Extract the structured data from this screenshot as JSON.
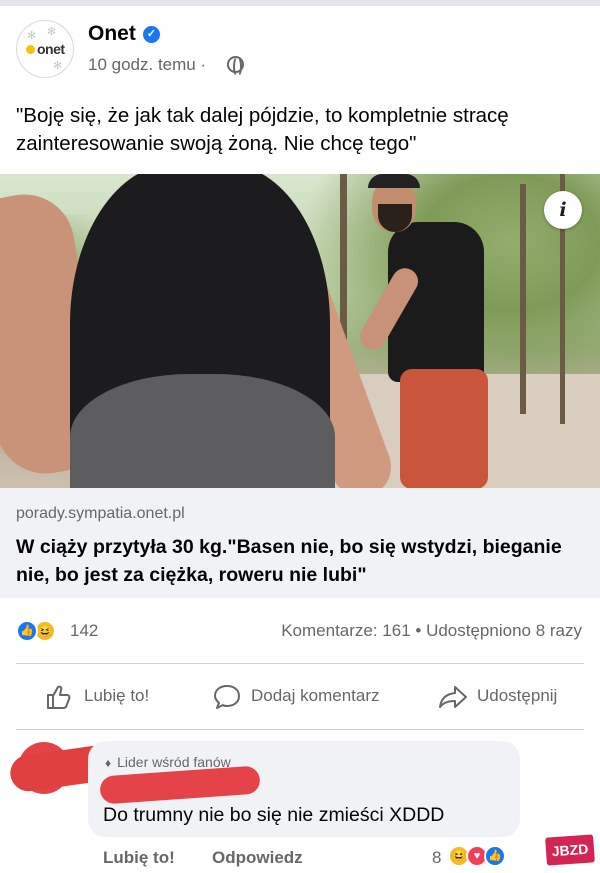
{
  "post": {
    "page_name": "Onet",
    "avatar_text": "onet",
    "time": "10 godz. temu ·",
    "text": "\"Boję się, że jak tak dalej pójdzie, to kompletnie stracę zainteresowanie swoją żoną. Nie chcę tego\""
  },
  "link": {
    "domain": "porady.sympatia.onet.pl",
    "title": "W ciąży przytyła 30 kg.\"Basen nie, bo się wstydzi, bieganie nie, bo jest za ciężka, roweru nie lubi\""
  },
  "stats": {
    "reactions_count": "142",
    "comments_shares": "Komentarze: 161 • Udostępniono 8 razy"
  },
  "actions": {
    "like": "Lubię to!",
    "comment": "Dodaj komentarz",
    "share": "Udostępnij"
  },
  "comment": {
    "badge": "Lider wśród fanów",
    "text": "Do trumny nie bo się nie zmieści XDDD",
    "like": "Lubię to!",
    "reply": "Odpowiedz",
    "reactions_count": "8"
  },
  "watermark": "JBZD",
  "colors": {
    "accent_blue": "#1877f2",
    "redaction_red": "#e4434a",
    "muted_text": "#65676b"
  },
  "icons": [
    "verified-icon",
    "globe-icon",
    "info-icon",
    "like-reaction-icon",
    "haha-reaction-icon",
    "love-reaction-icon",
    "thumbs-up-icon",
    "comment-icon",
    "share-icon",
    "gem-icon"
  ]
}
